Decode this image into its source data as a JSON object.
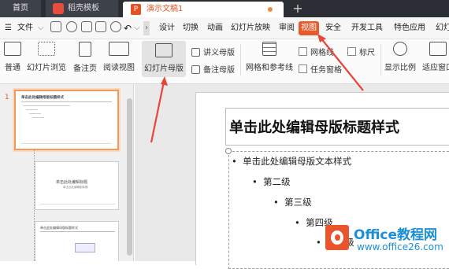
{
  "tabs": {
    "home": "首页",
    "template": "稻壳模板",
    "document": "演示文稿1",
    "new_tab": "+"
  },
  "menu": {
    "file": "文件",
    "items": [
      "设计",
      "切换",
      "动画",
      "幻灯片放映",
      "审阅",
      "视图",
      "安全",
      "开发工具",
      "特色应用",
      "幻灯"
    ],
    "active": "视图"
  },
  "ribbon": {
    "normal": "普通",
    "sorter": "幻灯片浏览",
    "notes_page": "备注页",
    "reading": "阅读视图",
    "slide_master": "幻灯片母版",
    "handout_master": "讲义母版",
    "notes_master": "备注母版",
    "grid_guides": "网格和参考线",
    "gridlines": "网格线",
    "ruler": "标尺",
    "task_pane": "任务窗格",
    "display_ratio": "显示比例",
    "fit_window": "适应窗口"
  },
  "thumbnails": {
    "slide_number": "1",
    "thumb1_title": "单击此处编辑母版标题样式",
    "thumb2_title": "单击此处编辑标题",
    "thumb2_sub": "单击此处编辑副标题",
    "thumb3_title": "单击此处编辑母版标题样式"
  },
  "slide": {
    "title": "单击此处编辑母版标题样式",
    "levels": [
      "单击此处编辑母版文本样式",
      "第二级",
      "第三级",
      "第四级",
      "第五级"
    ]
  },
  "watermark": {
    "line1": "Office教程网",
    "line2": "www.office26.com"
  },
  "colors": {
    "accent": "#e95a2b",
    "arrow": "#e8453c",
    "watermark": "#1b8fd8"
  }
}
